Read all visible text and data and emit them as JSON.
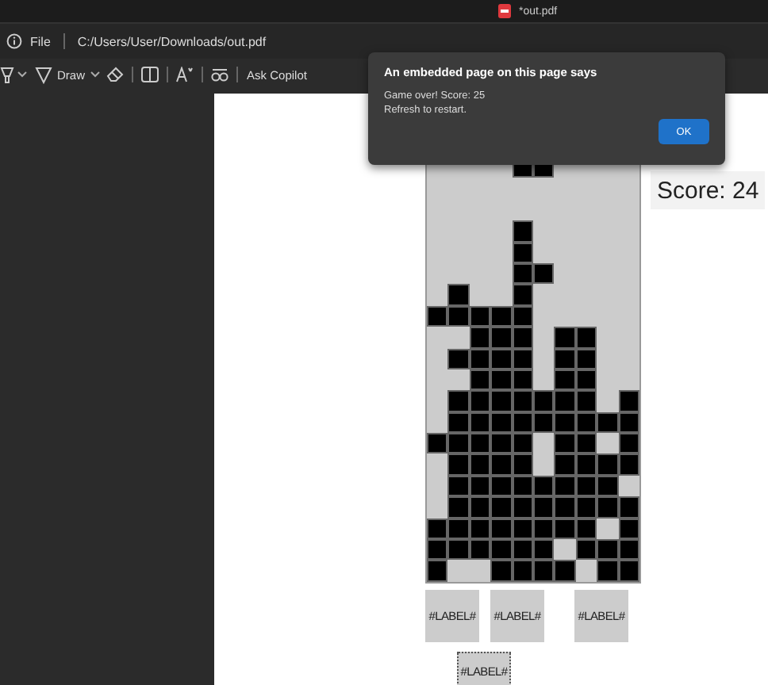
{
  "window": {
    "title": "*out.pdf"
  },
  "address_bar": {
    "scheme": "File",
    "url": "C:/Users/User/Downloads/out.pdf"
  },
  "toolbar": {
    "draw_label": "Draw",
    "copilot_label": "Ask Copilot"
  },
  "board": {
    "rows": [
      [
        false,
        false,
        false,
        false,
        true,
        true,
        false,
        false,
        false,
        false
      ],
      [
        false,
        false,
        false,
        false,
        false,
        false,
        false,
        false,
        false,
        false
      ],
      [
        false,
        false,
        false,
        false,
        false,
        false,
        false,
        false,
        false,
        false
      ],
      [
        false,
        false,
        false,
        false,
        true,
        false,
        false,
        false,
        false,
        false
      ],
      [
        false,
        false,
        false,
        false,
        true,
        false,
        false,
        false,
        false,
        false
      ],
      [
        false,
        false,
        false,
        false,
        true,
        true,
        false,
        false,
        false,
        false
      ],
      [
        false,
        true,
        false,
        false,
        true,
        false,
        false,
        false,
        false,
        false
      ],
      [
        true,
        true,
        true,
        true,
        true,
        false,
        false,
        false,
        false,
        false
      ],
      [
        false,
        false,
        true,
        true,
        true,
        false,
        true,
        true,
        false,
        false
      ],
      [
        false,
        true,
        true,
        true,
        true,
        false,
        true,
        true,
        false,
        false
      ],
      [
        false,
        false,
        true,
        true,
        true,
        false,
        true,
        true,
        false,
        false
      ],
      [
        false,
        true,
        true,
        true,
        true,
        true,
        true,
        true,
        false,
        true
      ],
      [
        false,
        true,
        true,
        true,
        true,
        true,
        true,
        true,
        true,
        true
      ],
      [
        true,
        true,
        true,
        true,
        true,
        false,
        true,
        true,
        false,
        true
      ],
      [
        false,
        true,
        true,
        true,
        true,
        false,
        true,
        true,
        true,
        true
      ],
      [
        false,
        true,
        true,
        true,
        true,
        true,
        true,
        true,
        true,
        false
      ],
      [
        false,
        true,
        true,
        true,
        true,
        true,
        true,
        true,
        true,
        true
      ],
      [
        true,
        true,
        true,
        true,
        true,
        true,
        true,
        true,
        false,
        true
      ],
      [
        true,
        true,
        true,
        true,
        true,
        true,
        false,
        true,
        true,
        true
      ],
      [
        true,
        false,
        false,
        true,
        true,
        true,
        true,
        false,
        true,
        true
      ]
    ]
  },
  "score": "Score: 24",
  "labels": [
    "#LABEL#",
    "#LABEL#",
    "#LABEL#",
    "#LABEL#"
  ],
  "dialog": {
    "title": "An embedded page on this page says",
    "lines": [
      "Game over! Score: 25",
      "Refresh to restart."
    ],
    "button": "OK"
  }
}
